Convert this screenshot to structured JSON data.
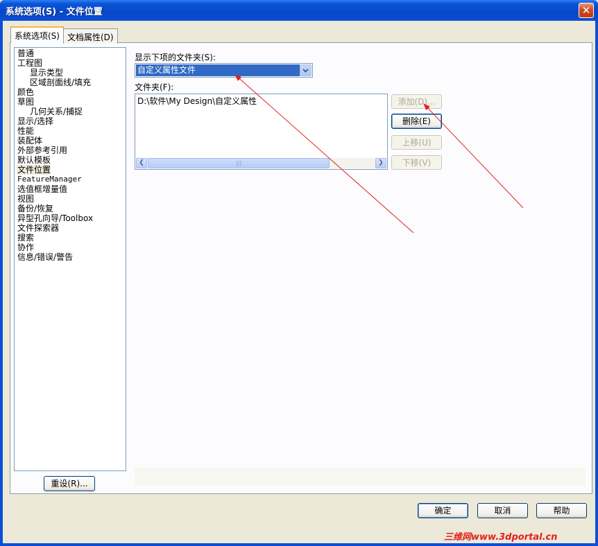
{
  "window": {
    "title": "系统选项(S) - 文件位置",
    "close_glyph": "✕"
  },
  "tabs": [
    {
      "label": "系统选项(S)",
      "active": true
    },
    {
      "label": "文档属性(D)",
      "active": false
    }
  ],
  "categories": [
    {
      "label": "普通",
      "indent": 0
    },
    {
      "label": "工程图",
      "indent": 0
    },
    {
      "label": "显示类型",
      "indent": 1
    },
    {
      "label": "区域剖面线/填充",
      "indent": 1
    },
    {
      "label": "颜色",
      "indent": 0
    },
    {
      "label": "草图",
      "indent": 0
    },
    {
      "label": "几何关系/捕捉",
      "indent": 1
    },
    {
      "label": "显示/选择",
      "indent": 0
    },
    {
      "label": "性能",
      "indent": 0
    },
    {
      "label": "装配体",
      "indent": 0
    },
    {
      "label": "外部参考引用",
      "indent": 0
    },
    {
      "label": "默认模板",
      "indent": 0
    },
    {
      "label": "文件位置",
      "indent": 0,
      "selected": true
    },
    {
      "label": "FeatureManager",
      "indent": 0
    },
    {
      "label": "选值框增量值",
      "indent": 0
    },
    {
      "label": "视图",
      "indent": 0
    },
    {
      "label": "备份/恢复",
      "indent": 0
    },
    {
      "label": "异型孔向导/Toolbox",
      "indent": 0
    },
    {
      "label": "文件探索器",
      "indent": 0
    },
    {
      "label": "搜索",
      "indent": 0
    },
    {
      "label": "协作",
      "indent": 0
    },
    {
      "label": "信息/错误/警告",
      "indent": 0
    }
  ],
  "reset_button": "重设(R)...",
  "show_folders_label": "显示下项的文件夹(S):",
  "show_folders_value": "自定义属性文件",
  "folders_label": "文件夹(F):",
  "folder_entries": [
    "D:\\软件\\My Design\\自定义属性"
  ],
  "side_buttons": {
    "add": "添加(D)...",
    "delete": "删除(E)",
    "move_up": "上移(U)",
    "move_down": "下移(V)"
  },
  "footer_buttons": {
    "ok": "确定",
    "cancel": "取消",
    "help": "帮助"
  },
  "watermark": "三维网www.3dportal.cn",
  "colors": {
    "titlebar": "#0a54d8",
    "selection": "#316ac5",
    "annotation_arrow": "#e02020"
  }
}
